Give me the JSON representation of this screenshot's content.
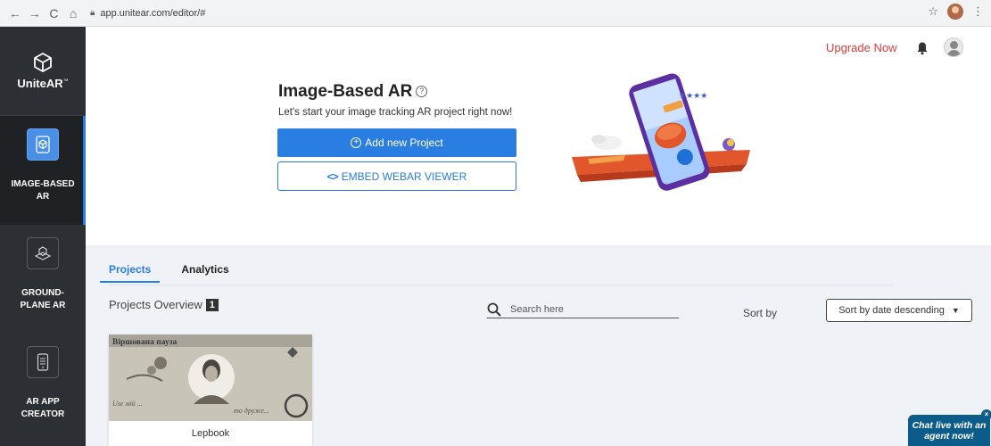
{
  "browser": {
    "url": "app.unitear.com/editor/#",
    "nav": {
      "back": "←",
      "forward": "→",
      "reload": "C",
      "home": "⌂"
    },
    "star": "☆",
    "menu": "⋮"
  },
  "sidebar": {
    "logo": "UniteAR",
    "logo_tm": "™",
    "items": [
      {
        "label": "IMAGE-BASED AR",
        "icon": "image-ar-icon",
        "active": true
      },
      {
        "label": "GROUND-PLANE AR",
        "icon": "ground-plane-icon",
        "active": false
      },
      {
        "label": "AR APP CREATOR",
        "icon": "app-creator-icon",
        "active": false
      }
    ]
  },
  "header": {
    "upgrade": "Upgrade Now",
    "title": "Image-Based AR",
    "help": "?",
    "subtitle": "Let's start your image tracking AR project right now!",
    "add_project": "Add new Project",
    "embed_viewer": "EMBED WEBAR VIEWER"
  },
  "content": {
    "tabs": [
      {
        "label": "Projects",
        "active": true
      },
      {
        "label": "Analytics",
        "active": false
      }
    ],
    "overview_label": "Projects Overview",
    "project_count": "1",
    "search_placeholder": "Search here",
    "sort_label": "Sort by",
    "sort_value": "Sort by date descending",
    "projects": [
      {
        "name": "Lepbook",
        "thumb_text": "Віршована пауза"
      }
    ]
  },
  "chat": {
    "text": "Chat live with an agent now!",
    "close": "×"
  },
  "colors": {
    "accent": "#2a7de1",
    "sidebar": "#2c2f33",
    "upgrade": "#e03b3b",
    "chat": "#0b5c8a"
  }
}
